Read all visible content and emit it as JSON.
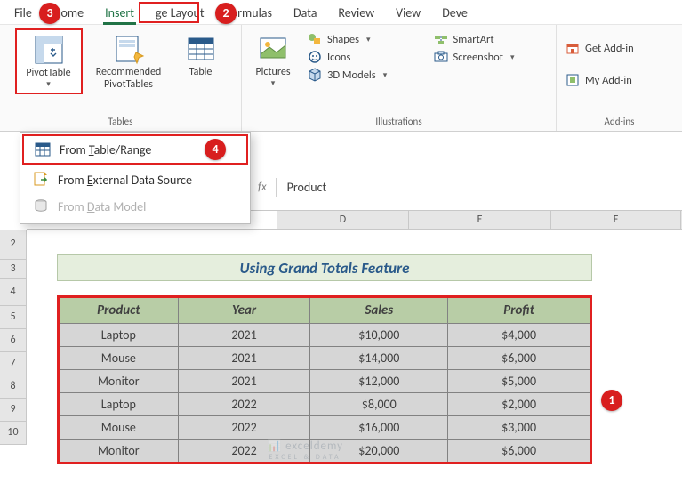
{
  "tabs": {
    "file": "File",
    "home": "Home",
    "insert": "Insert",
    "page_layout": "ge Layout",
    "formulas": "Formulas",
    "data": "Data",
    "review": "Review",
    "view": "View",
    "developer": "Deve"
  },
  "ribbon": {
    "pivot": "PivotTable",
    "recommended": "Recommended\nPivotTables",
    "table": "Table",
    "pictures": "Pictures",
    "shapes": "Shapes",
    "icons": "Icons",
    "models": "3D Models",
    "smartart": "SmartArt",
    "screenshot": "Screenshot",
    "grp_tables": "Tables",
    "grp_illus": "Illustrations",
    "get_addins": "Get Add-in",
    "my_addins": "My Add-in",
    "grp_addins": "Add-ins"
  },
  "dropdown": {
    "from_table": "From Table/Range",
    "from_ext": "From External Data Source",
    "from_dm": "From Data Model"
  },
  "fx": {
    "label": "fx",
    "value": "Product"
  },
  "cols": {
    "d": "D",
    "e": "E",
    "f": "F"
  },
  "rows": {
    "r2": "2",
    "r3": "3",
    "r4": "4",
    "r5": "5",
    "r6": "6",
    "r7": "7",
    "r8": "8",
    "r9": "9",
    "r10": "10"
  },
  "sheet": {
    "title": "Using Grand Totals Feature",
    "headers": {
      "product": "Product",
      "year": "Year",
      "sales": "Sales",
      "profit": "Profit"
    },
    "rows": [
      {
        "product": "Laptop",
        "year": "2021",
        "sales": "$10,000",
        "profit": "$4,000"
      },
      {
        "product": "Mouse",
        "year": "2021",
        "sales": "$14,000",
        "profit": "$6,000"
      },
      {
        "product": "Monitor",
        "year": "2021",
        "sales": "$12,000",
        "profit": "$5,000"
      },
      {
        "product": "Laptop",
        "year": "2022",
        "sales": "$8,000",
        "profit": "$2,000"
      },
      {
        "product": "Mouse",
        "year": "2022",
        "sales": "$16,000",
        "profit": "$3,000"
      },
      {
        "product": "Monitor",
        "year": "2022",
        "sales": "$20,000",
        "profit": "$6,000"
      }
    ]
  },
  "badges": {
    "b1": "1",
    "b2": "2",
    "b3": "3",
    "b4": "4"
  },
  "watermark": {
    "main": "exceldemy",
    "sub": "EXCEL & DATA"
  }
}
